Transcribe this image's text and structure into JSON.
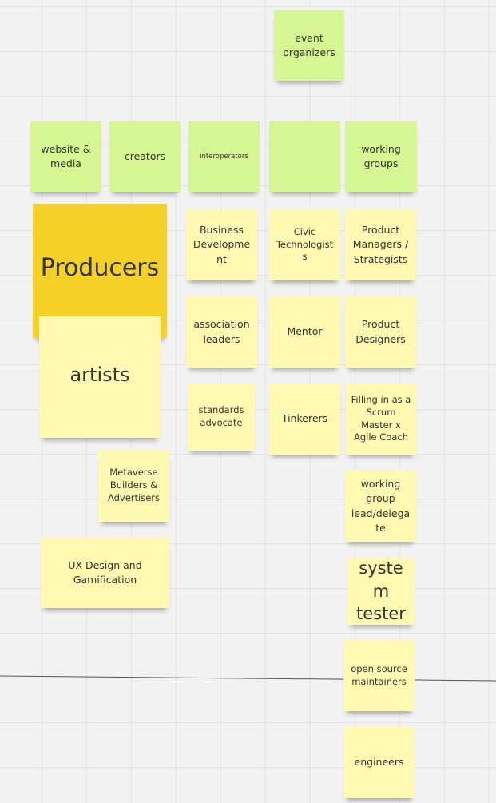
{
  "notes": {
    "event_organizers": "event organizers",
    "website_media": "website & media",
    "creators": "creators",
    "interoperators": "interoperators",
    "blank": "",
    "working_groups": "working groups",
    "producers": "Producers",
    "artists": "artists",
    "business_development": "Business Developme nt",
    "association_leaders": "association leaders",
    "standards_advocate": "standards advocate",
    "civic_technologists": "Civic Technologists",
    "mentor": "Mentor",
    "tinkerers": "Tinkerers",
    "product_managers": "Product Managers / Strategists",
    "product_designers": "Product Designers",
    "scrum_master": "Filling in as a Scrum Master x Agile Coach",
    "metaverse_builders": "Metaverse Builders & Advertisers",
    "ux_design": "UX Design and Gamification",
    "working_group_lead": "working group lead/delega te",
    "system_tester": "system tester",
    "open_source_maintainers": "open source maintainers",
    "engineers": "engineers"
  },
  "colors": {
    "green": "#d5f692",
    "yellow": "#fff9b1",
    "gold": "#f5d128",
    "canvas": "#f2f2f2"
  }
}
